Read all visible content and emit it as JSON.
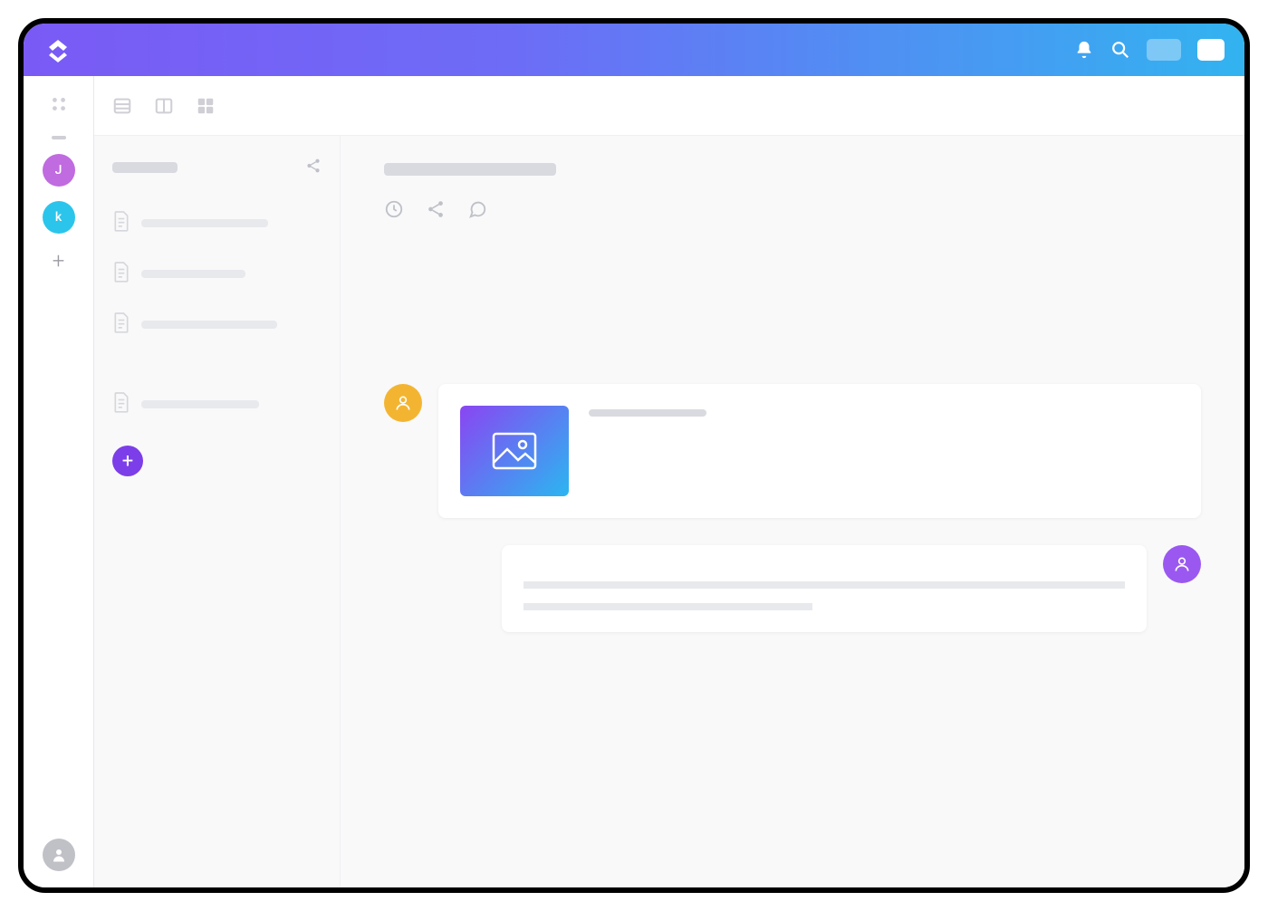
{
  "brand": {
    "name": "ClickUp"
  },
  "topbar": {
    "notifications": "Notifications",
    "search": "Search"
  },
  "rail": {
    "workspaces": [
      {
        "letter": "J",
        "color": "#c06be0"
      },
      {
        "letter": "k",
        "color": "#2bc5ec"
      }
    ],
    "add": "+",
    "profile": "Profile"
  },
  "view_tabs": [
    {
      "name": "list",
      "label": "List"
    },
    {
      "name": "board",
      "label": "Board"
    },
    {
      "name": "grid",
      "label": "Grid"
    }
  ],
  "sidebar": {
    "title": "",
    "share": "Share",
    "docs": [
      {
        "label": "",
        "children": []
      },
      {
        "label": "",
        "children": []
      },
      {
        "label": "",
        "children": [
          "",
          "",
          ""
        ]
      },
      {
        "label": "",
        "children": []
      }
    ],
    "add": "+"
  },
  "document": {
    "title": "",
    "actions": {
      "history": "History",
      "share": "Share",
      "comment": "Comment"
    },
    "paragraph_lines": [
      "",
      "",
      "",
      "",
      ""
    ]
  },
  "comments": [
    {
      "side": "left",
      "author_color": "orange",
      "has_attachment": true,
      "title": "",
      "lines": [
        "",
        ""
      ]
    },
    {
      "side": "right",
      "author_color": "purple",
      "has_attachment": false,
      "title": "",
      "lines": [
        "",
        ""
      ]
    }
  ]
}
